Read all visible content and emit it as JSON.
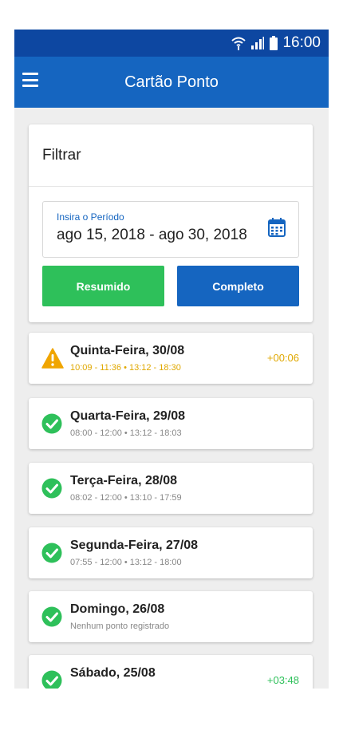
{
  "status_bar": {
    "time": "16:00"
  },
  "app_bar": {
    "title": "Cartão Ponto"
  },
  "filter": {
    "heading": "Filtrar",
    "period_label": "Insira o Período",
    "period_value": "ago 15, 2018 - ago 30, 2018",
    "resumido_label": "Resumido",
    "completo_label": "Completo"
  },
  "days": [
    {
      "title": "Quinta-Feira, 30/08",
      "times": "10:09 - 11:36 • 13:12 - 18:30",
      "extra": "+00:06",
      "status": "warning"
    },
    {
      "title": "Quarta-Feira, 29/08",
      "times": "08:00 - 12:00 • 13:12 - 18:03",
      "extra": "",
      "status": "ok"
    },
    {
      "title": "Terça-Feira, 28/08",
      "times": "08:02 - 12:00 • 13:10 - 17:59",
      "extra": "",
      "status": "ok"
    },
    {
      "title": "Segunda-Feira, 27/08",
      "times": "07:55 - 12:00 • 13:12 - 18:00",
      "extra": "",
      "status": "ok"
    },
    {
      "title": "Domingo, 26/08",
      "times": "Nenhum ponto registrado",
      "extra": "",
      "status": "ok"
    },
    {
      "title": "Sábado, 25/08",
      "times": "",
      "extra": "+03:48",
      "status": "ok"
    }
  ],
  "colors": {
    "status_bar": "#0d47a1",
    "app_bar": "#1565c0",
    "ok": "#2ec05a",
    "warning": "#f0a500",
    "primary_button": "#1565c0",
    "secondary_button": "#2ec05a"
  },
  "icons": {
    "menu": "hamburger-icon",
    "calendar": "calendar-icon",
    "ok": "check-circle-icon",
    "warning": "warning-triangle-icon"
  }
}
